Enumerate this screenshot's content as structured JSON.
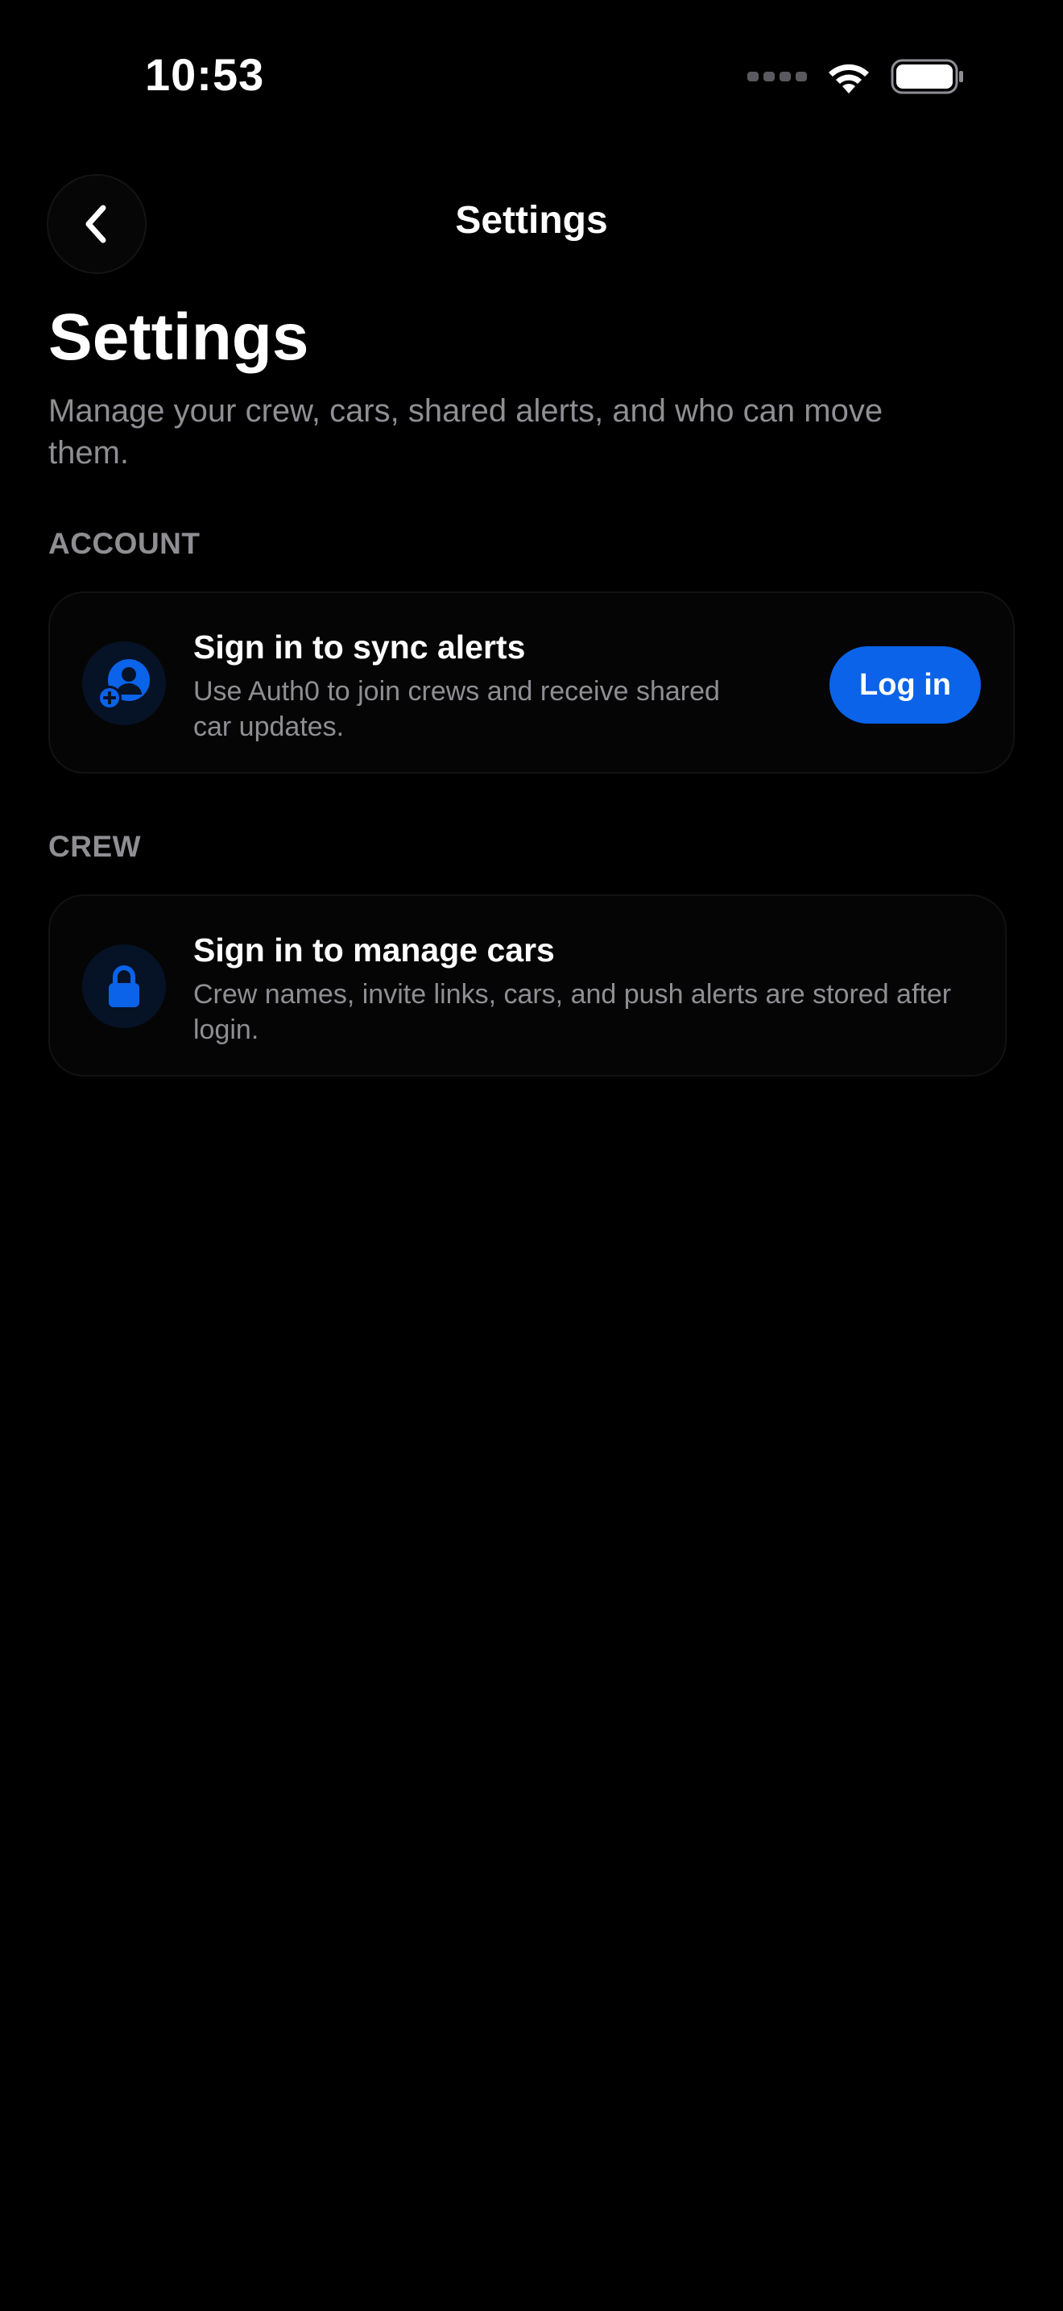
{
  "status_bar": {
    "time": "10:53",
    "icons": [
      "cellular-signal-icon",
      "wifi-icon",
      "battery-icon"
    ]
  },
  "nav": {
    "title": "Settings",
    "back_icon": "chevron-left-icon"
  },
  "header": {
    "title": "Settings",
    "subtitle": "Manage your crew, cars, shared alerts, and who can move them."
  },
  "account": {
    "section_label": "ACCOUNT",
    "card": {
      "icon": "user-add-icon",
      "title": "Sign in to sync alerts",
      "description": "Use Auth0 to join crews and receive shared car updates.",
      "button_label": "Log in"
    }
  },
  "crew": {
    "section_label": "CREW",
    "card": {
      "icon": "lock-icon",
      "title": "Sign in to manage cars",
      "description": "Crew names, invite links, cars, and push alerts are stored after login."
    }
  },
  "colors": {
    "background": "#000000",
    "accent": "#0a63e8",
    "secondary_text": "#8e8e93"
  }
}
